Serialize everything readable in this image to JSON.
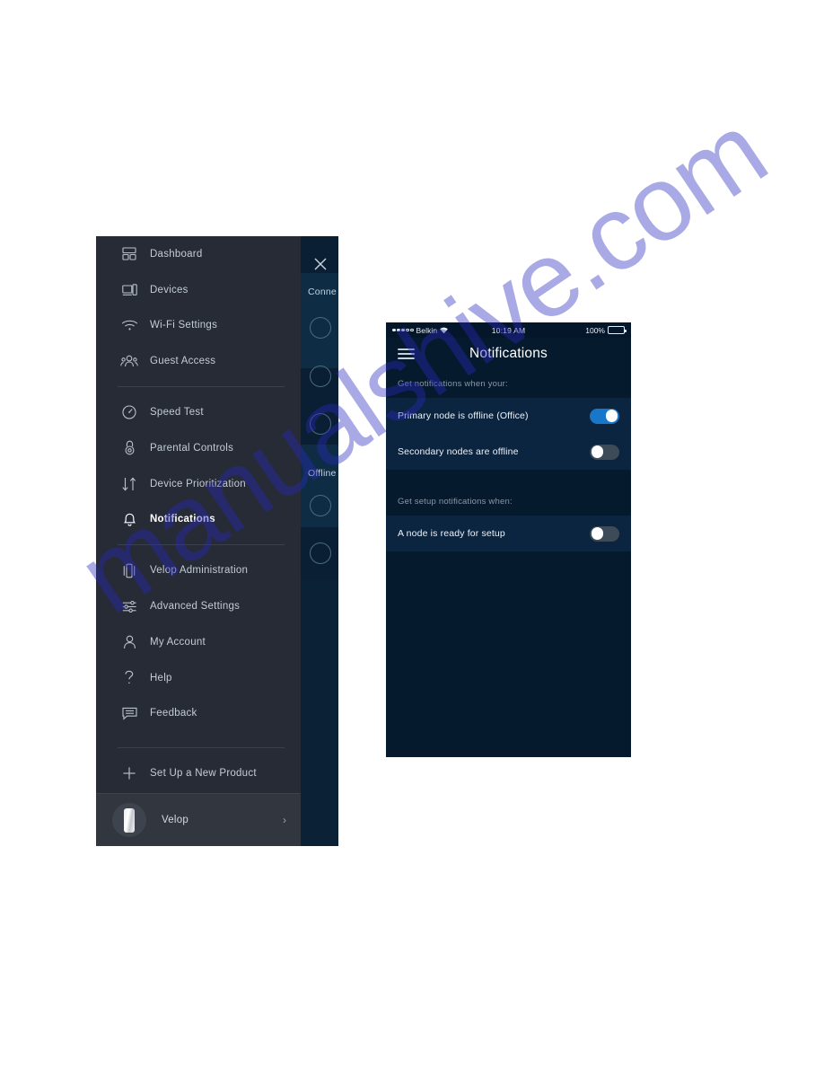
{
  "watermark": {
    "text": "manualshive.com",
    "color": "#2828be"
  },
  "drawer": {
    "close_icon": "close-icon",
    "items": [
      {
        "id": "dashboard",
        "label": "Dashboard",
        "icon": "dashboard-icon",
        "active": false
      },
      {
        "id": "devices",
        "label": "Devices",
        "icon": "devices-icon",
        "active": false
      },
      {
        "id": "wifi-settings",
        "label": "Wi-Fi Settings",
        "icon": "wifi-icon",
        "active": false
      },
      {
        "id": "guest-access",
        "label": "Guest Access",
        "icon": "guest-access-icon",
        "active": false
      },
      {
        "id": "speed-test",
        "label": "Speed Test",
        "icon": "speedometer-icon",
        "active": false
      },
      {
        "id": "parental-controls",
        "label": "Parental Controls",
        "icon": "lock-icon",
        "active": false
      },
      {
        "id": "device-prioritization",
        "label": "Device Prioritization",
        "icon": "up-down-arrows-icon",
        "active": false
      },
      {
        "id": "notifications",
        "label": "Notifications",
        "icon": "bell-icon",
        "active": true
      },
      {
        "id": "velop-administration",
        "label": "Velop Administration",
        "icon": "node-icon",
        "active": false
      },
      {
        "id": "advanced-settings",
        "label": "Advanced Settings",
        "icon": "sliders-icon",
        "active": false
      },
      {
        "id": "my-account",
        "label": "My Account",
        "icon": "person-icon",
        "active": false
      },
      {
        "id": "help",
        "label": "Help",
        "icon": "question-mark-icon",
        "active": false
      },
      {
        "id": "feedback",
        "label": "Feedback",
        "icon": "chat-bubble-icon",
        "active": false
      },
      {
        "id": "set-up-a-new-product",
        "label": "Set Up a New Product",
        "icon": "plus-icon",
        "active": false
      }
    ],
    "footer": {
      "label": "Velop",
      "chevron": "›"
    }
  },
  "background_screen": {
    "connected_label": "Conne",
    "offline_label": "Offline"
  },
  "phone": {
    "statusbar": {
      "carrier": "Belkin",
      "time": "10:19 AM",
      "battery_percent": "100%"
    },
    "navbar": {
      "title": "Notifications",
      "menu_icon": "hamburger-icon"
    },
    "sections": [
      {
        "header": "Get notifications when your:",
        "rows": [
          {
            "label": "Primary node is offline (Office)",
            "toggle": "on"
          },
          {
            "label": "Secondary nodes are offline",
            "toggle": "off"
          }
        ]
      },
      {
        "header": "Get setup notifications when:",
        "rows": [
          {
            "label": "A node is ready for setup",
            "toggle": "off"
          }
        ]
      }
    ],
    "colors": {
      "screen_bg": "#061a2e",
      "row_bg": "#0b2540",
      "toggle_on": "#1877c9",
      "toggle_off": "#3d4a57"
    }
  }
}
